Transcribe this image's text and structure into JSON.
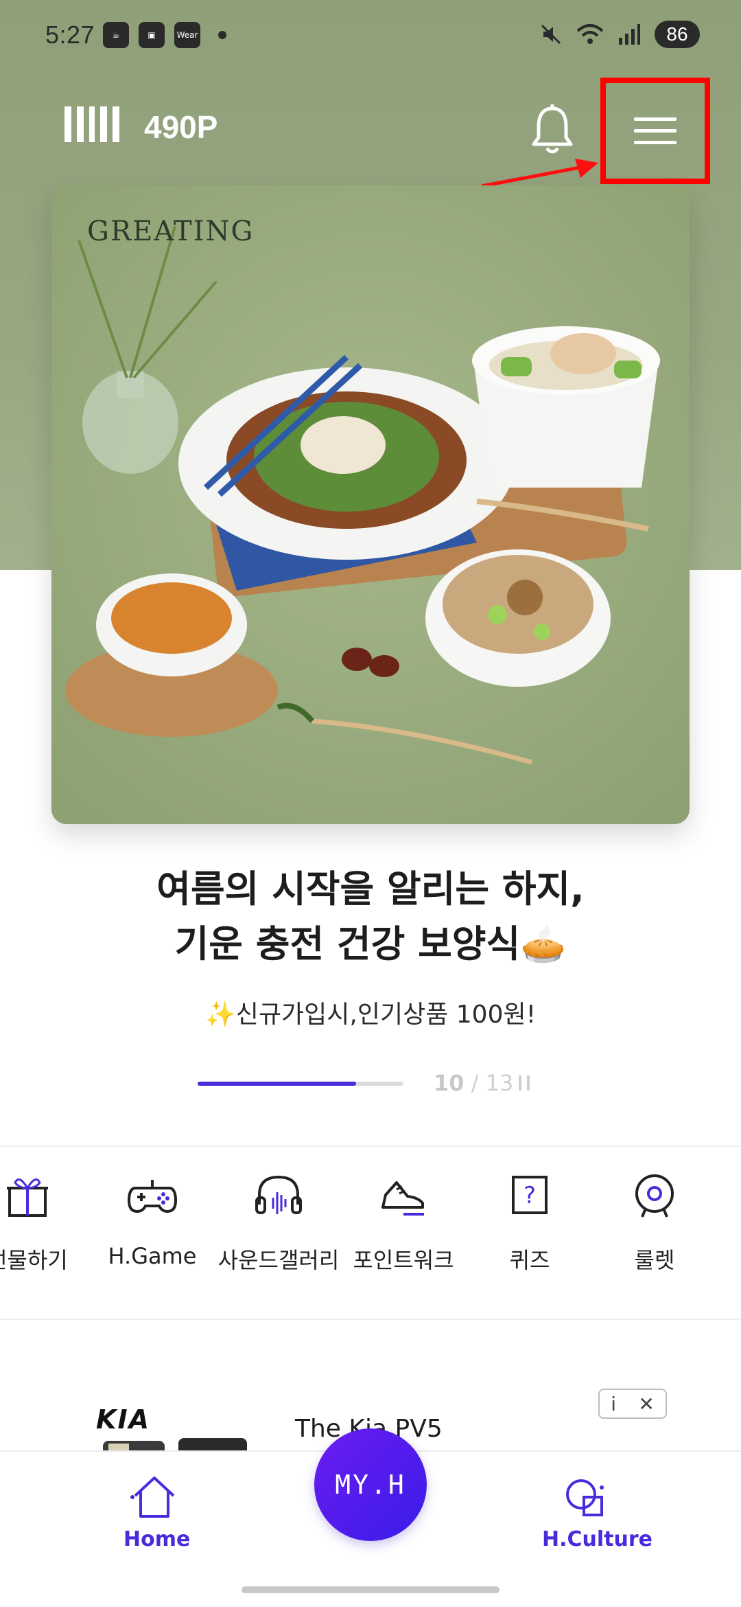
{
  "status_bar": {
    "time": "5:27",
    "battery": "86",
    "wear_label": "Wear"
  },
  "header": {
    "points": "490P",
    "bell_icon": "bell-icon",
    "menu_icon": "hamburger-menu-icon"
  },
  "banner": {
    "brand": "GREATING",
    "title_line1": "여름의 시작을 알리는 하지,",
    "title_line2": "기운 충전 건강 보양식🥧",
    "subtitle": "✨신규가입시,인기상품 100원!",
    "progress": 0.77,
    "current_page": "10",
    "page_sep": "/",
    "total_pages": "13"
  },
  "quick_menu": [
    {
      "label": "선물하기",
      "icon": "gift-icon"
    },
    {
      "label": "H.Game",
      "icon": "gamepad-icon"
    },
    {
      "label": "사운드갤러리",
      "icon": "headphones-icon"
    },
    {
      "label": "포인트워크",
      "icon": "sneaker-icon"
    },
    {
      "label": "퀴즈",
      "icon": "quiz-icon"
    },
    {
      "label": "룰렛",
      "icon": "roulette-icon"
    }
  ],
  "ad": {
    "brand": "KIA",
    "text": "The Kia PV5",
    "info": "i",
    "close": "✕"
  },
  "bottom_nav": {
    "home": "Home",
    "center": "MY.H",
    "culture": "H.Culture"
  },
  "colors": {
    "accent": "#4a2bdb",
    "highlight": "#ff0000",
    "hero_bg": "#98a782"
  }
}
